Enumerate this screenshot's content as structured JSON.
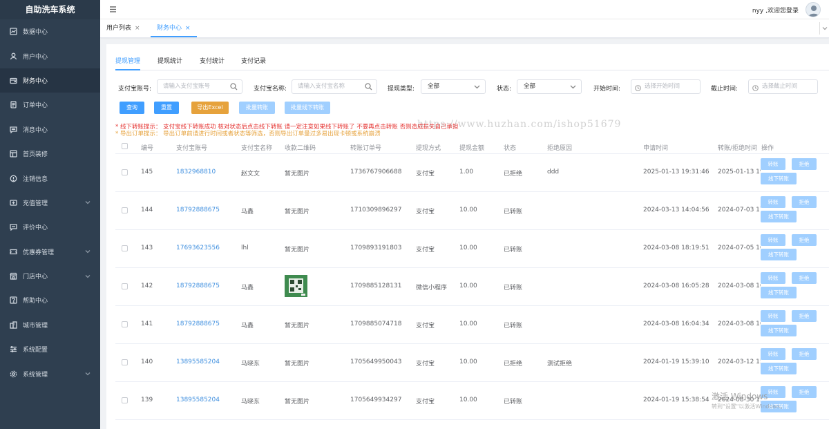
{
  "app": {
    "title": "自助洗车系统"
  },
  "sidebar": {
    "items": [
      {
        "label": "数据中心",
        "icon": "chart-icon",
        "expandable": false
      },
      {
        "label": "用户中心",
        "icon": "user-icon",
        "expandable": false
      },
      {
        "label": "财务中心",
        "icon": "wallet-icon",
        "expandable": false,
        "active": true
      },
      {
        "label": "订单中心",
        "icon": "order-icon",
        "expandable": false
      },
      {
        "label": "消息中心",
        "icon": "message-icon",
        "expandable": false
      },
      {
        "label": "首页装修",
        "icon": "home-decor-icon",
        "expandable": false
      },
      {
        "label": "注销信息",
        "icon": "logout-info-icon",
        "expandable": false
      },
      {
        "label": "充值管理",
        "icon": "recharge-icon",
        "expandable": true
      },
      {
        "label": "评价中心",
        "icon": "review-icon",
        "expandable": false
      },
      {
        "label": "优惠券管理",
        "icon": "coupon-icon",
        "expandable": true
      },
      {
        "label": "门店中心",
        "icon": "store-icon",
        "expandable": true
      },
      {
        "label": "帮助中心",
        "icon": "help-icon",
        "expandable": false
      },
      {
        "label": "城市管理",
        "icon": "city-icon",
        "expandable": false
      },
      {
        "label": "系统配置",
        "icon": "config-icon",
        "expandable": false
      },
      {
        "label": "系统管理",
        "icon": "settings-icon",
        "expandable": true
      }
    ]
  },
  "header": {
    "welcome": "nyy ,欢迎您登录"
  },
  "tabs": [
    {
      "label": "用户列表",
      "close": "×"
    },
    {
      "label": "财务中心",
      "close": "×",
      "active": true
    }
  ],
  "subtabs": [
    "提现管理",
    "提现统计",
    "支付统计",
    "支付记录"
  ],
  "filters": {
    "alipay_account_label": "支付宝账号:",
    "alipay_account_placeholder": "请输入支付宝账号",
    "alipay_name_label": "支付宝名称:",
    "alipay_name_placeholder": "请输入支付宝名称",
    "withdraw_type_label": "提现类型:",
    "withdraw_type_value": "全部",
    "status_label": "状态:",
    "status_value": "全部",
    "start_label": "开始时间:",
    "start_placeholder": "选择开始时间",
    "end_label": "截止时间:",
    "end_placeholder": "选择截止时间"
  },
  "buttons": {
    "query": "查询",
    "reset": "重置",
    "export": "导出Excel",
    "batch_transfer": "批量转账",
    "batch_offline": "批量线下转账"
  },
  "tips": {
    "offline": "* 线下转账提示： 支付宝线下转账成功 核对状态后点击线下转账 请一定注意如果线下转账了 不要再点击转账 否则造成损失自己承担",
    "export": "* 导出订单提示： 导出订单前请进行时间或者状态等筛选，否则导出订单量过多易出现卡顿或系统崩溃"
  },
  "table": {
    "columns": [
      "编号",
      "支付宝账号",
      "支付宝名称",
      "收款二维码",
      "转账订单号",
      "提现方式",
      "提现金额",
      "状态",
      "拒绝原因",
      "申请时间",
      "转账/拒绝时间",
      "操作"
    ],
    "actions": {
      "transfer": "转账",
      "reject": "拒绝",
      "offline": "线下转账"
    },
    "rows": [
      {
        "id": "145",
        "account": "1832968810",
        "name": "赵文文",
        "qr": "暂无图片",
        "order": "1736767906688",
        "method": "支付宝",
        "amount": "1.00",
        "status": "已拒绝",
        "reason": "ddd",
        "apply": "2025-01-13 19:31:46",
        "done": "2025-01-13 19"
      },
      {
        "id": "144",
        "account": "18792888675",
        "name": "马鑫",
        "qr": "暂无图片",
        "order": "1710309896297",
        "method": "支付宝",
        "amount": "10.00",
        "status": "已转账",
        "reason": "",
        "apply": "2024-03-13 14:04:56",
        "done": "2024-07-03 17"
      },
      {
        "id": "143",
        "account": "17693623556",
        "name": "lhl",
        "qr": "暂无图片",
        "order": "1709893191803",
        "method": "支付宝",
        "amount": "10.00",
        "status": "已转账",
        "reason": "",
        "apply": "2024-03-08 18:19:51",
        "done": "2024-07-05 16"
      },
      {
        "id": "142",
        "account": "18792888675",
        "name": "马鑫",
        "qr": "",
        "order": "1709885128131",
        "method": "微信小程序",
        "amount": "10.00",
        "status": "已转账",
        "reason": "",
        "apply": "2024-03-08 16:05:28",
        "done": "2024-03-08 16"
      },
      {
        "id": "141",
        "account": "18792888675",
        "name": "马鑫",
        "qr": "暂无图片",
        "order": "1709885074718",
        "method": "支付宝",
        "amount": "10.00",
        "status": "已转账",
        "reason": "",
        "apply": "2024-03-08 16:04:34",
        "done": "2024-03-08 16"
      },
      {
        "id": "140",
        "account": "13895585204",
        "name": "马晓东",
        "qr": "暂无图片",
        "order": "1705649950043",
        "method": "支付宝",
        "amount": "10.00",
        "status": "已拒绝",
        "reason": "测试拒绝",
        "apply": "2024-01-19 15:39:10",
        "done": "2024-03-12 15"
      },
      {
        "id": "139",
        "account": "13895585204",
        "name": "马晓东",
        "qr": "暂无图片",
        "order": "1705649934297",
        "method": "支付宝",
        "amount": "10.00",
        "status": "已转账",
        "reason": "",
        "apply": "2024-01-19 15:38:54",
        "done": "2024-08-30 15"
      }
    ]
  },
  "watermark": "https://www.huzhan.com/ishop51679",
  "activation": {
    "line1": "激活 Windows",
    "line2": "转到\"设置\"以激活Windows。"
  }
}
